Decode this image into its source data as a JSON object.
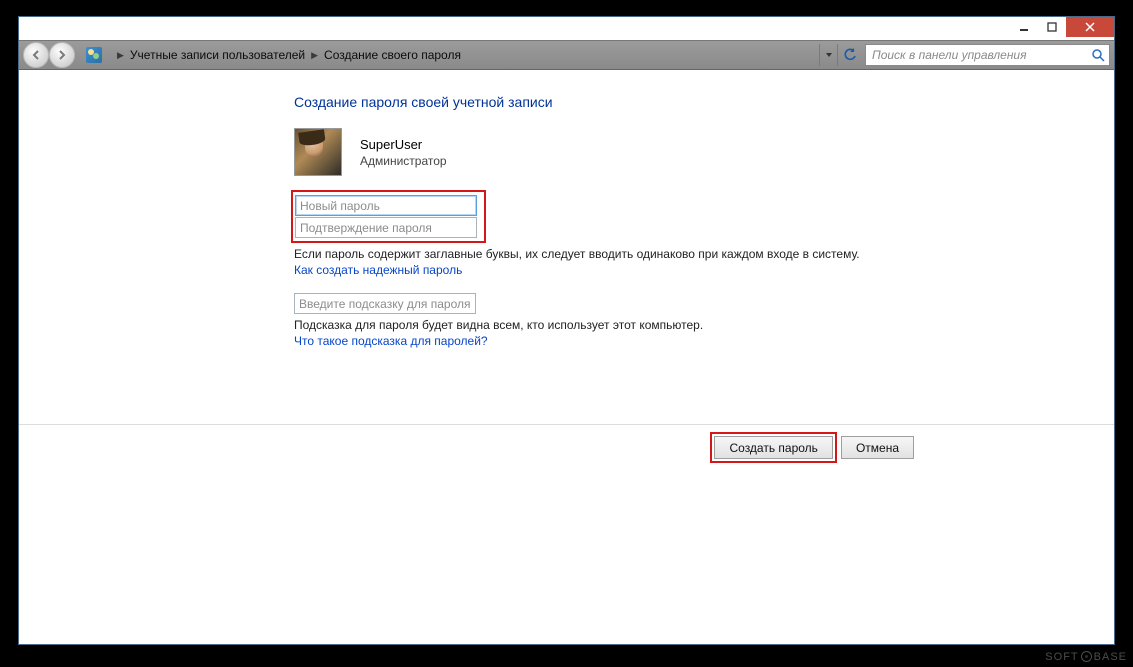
{
  "breadcrumb": {
    "item1": "Учетные записи пользователей",
    "item2": "Создание своего пароля"
  },
  "search": {
    "placeholder": "Поиск в панели управления"
  },
  "page": {
    "heading": "Создание пароля своей учетной записи"
  },
  "user": {
    "name": "SuperUser",
    "role": "Администратор"
  },
  "inputs": {
    "new_password_placeholder": "Новый пароль",
    "confirm_password_placeholder": "Подтверждение пароля",
    "hint_placeholder": "Введите подсказку для пароля"
  },
  "notes": {
    "caps_note": "Если пароль содержит заглавные буквы, их следует вводить одинаково при каждом входе в систему.",
    "strong_link": "Как создать надежный пароль",
    "hint_note": "Подсказка для пароля будет видна всем, кто использует этот компьютер.",
    "hint_link": "Что такое подсказка для паролей?"
  },
  "buttons": {
    "create": "Создать пароль",
    "cancel": "Отмена"
  },
  "watermark": {
    "left": "SOFT",
    "right": "BASE"
  }
}
